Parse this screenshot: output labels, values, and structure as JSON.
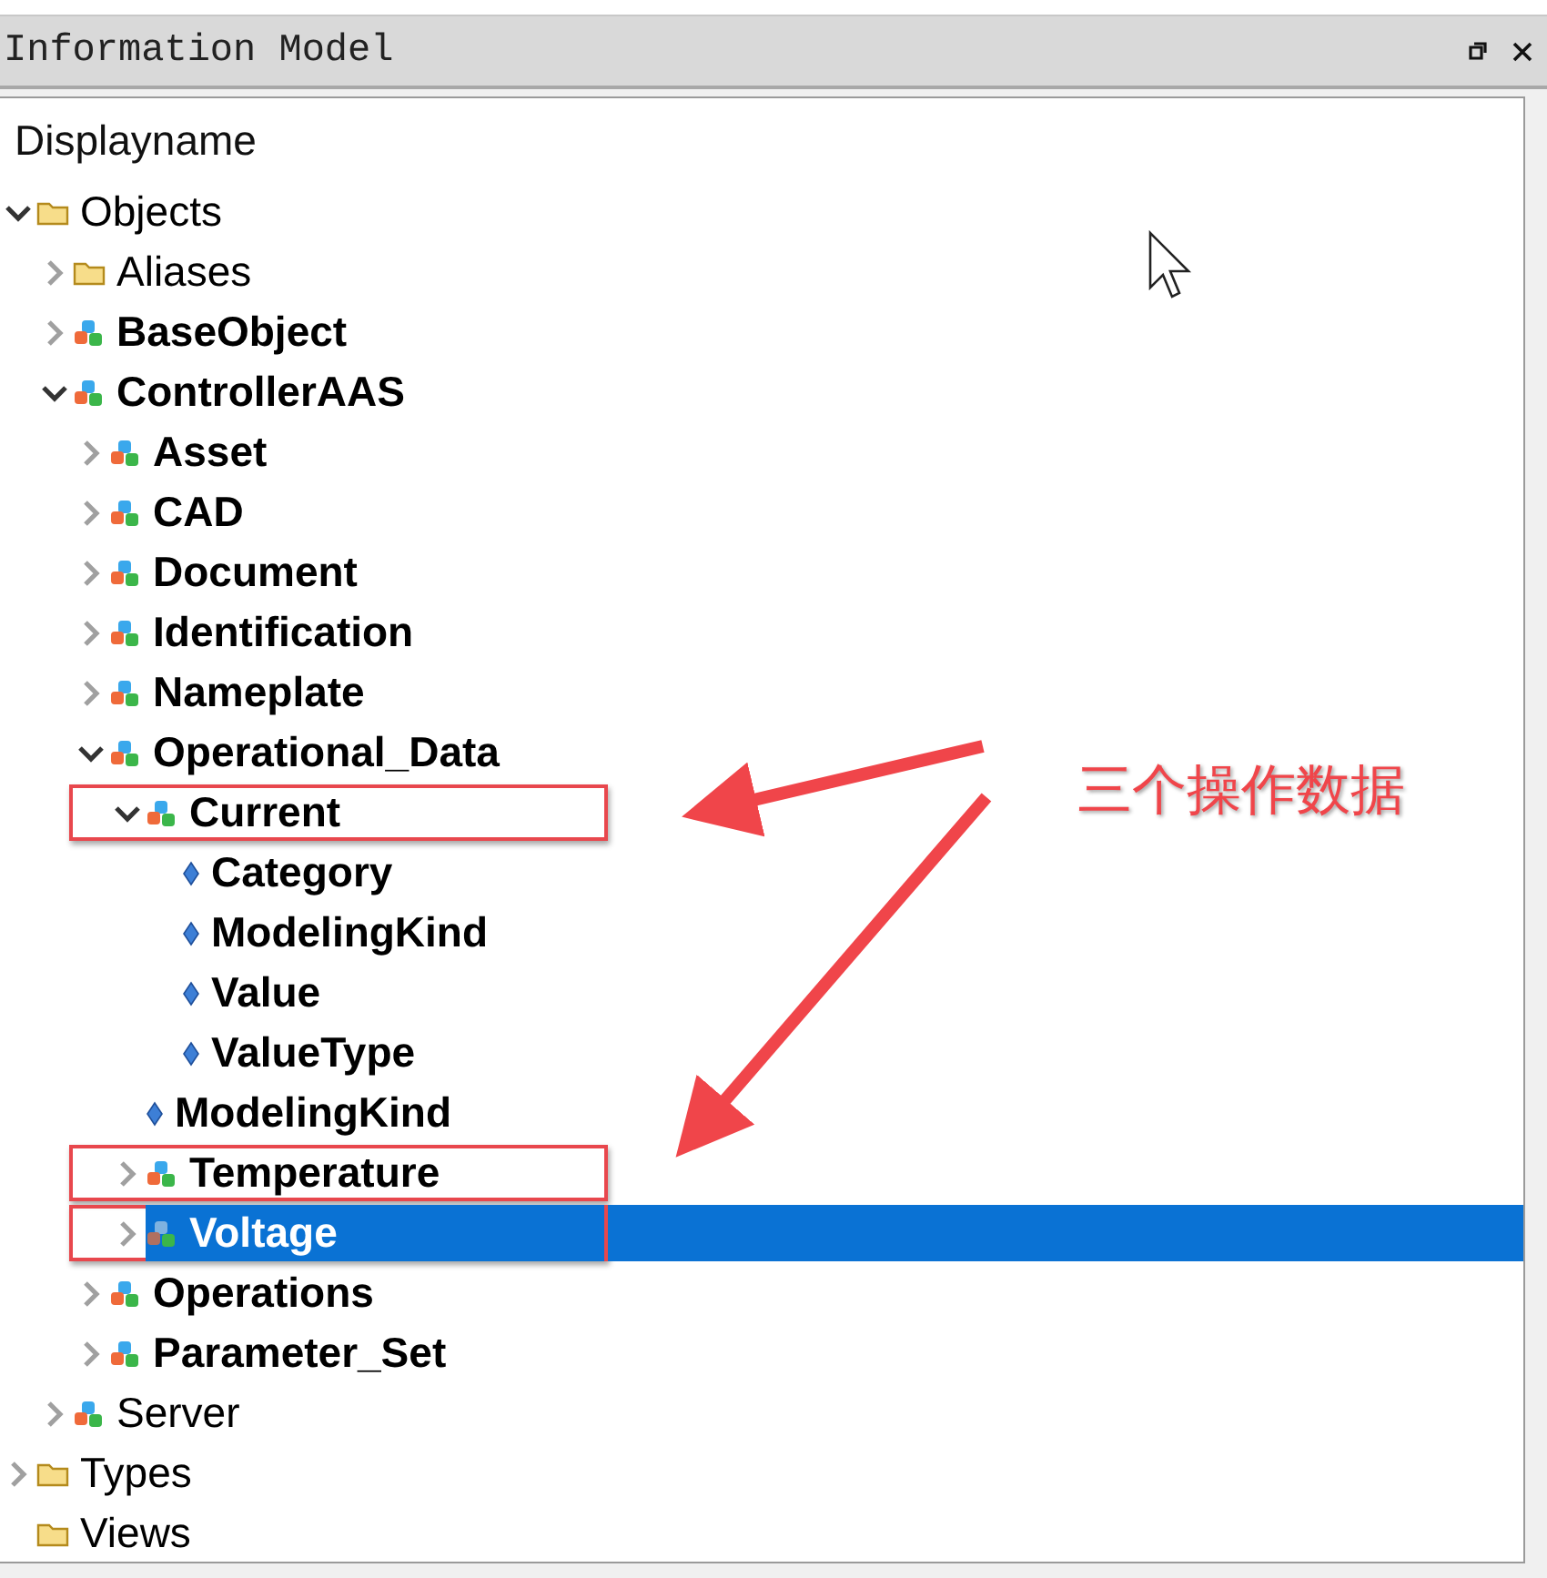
{
  "window": {
    "title": "Information Model"
  },
  "column_header": "Displayname",
  "tree": [
    {
      "label": "Objects",
      "kind": "folder",
      "bold": false,
      "expanded": true,
      "selected": false,
      "framed": false,
      "children": [
        {
          "label": "Aliases",
          "kind": "folder",
          "bold": false,
          "expanded": false,
          "selected": false,
          "framed": false
        },
        {
          "label": "BaseObject",
          "kind": "object",
          "bold": true,
          "expanded": false,
          "selected": false,
          "framed": false
        },
        {
          "label": "ControllerAAS",
          "kind": "object",
          "bold": true,
          "expanded": true,
          "selected": false,
          "framed": false,
          "children": [
            {
              "label": "Asset",
              "kind": "object",
              "bold": true,
              "expanded": false,
              "selected": false,
              "framed": false
            },
            {
              "label": "CAD",
              "kind": "object",
              "bold": true,
              "expanded": false,
              "selected": false,
              "framed": false
            },
            {
              "label": "Document",
              "kind": "object",
              "bold": true,
              "expanded": false,
              "selected": false,
              "framed": false
            },
            {
              "label": "Identification",
              "kind": "object",
              "bold": true,
              "expanded": false,
              "selected": false,
              "framed": false
            },
            {
              "label": "Nameplate",
              "kind": "object",
              "bold": true,
              "expanded": false,
              "selected": false,
              "framed": false
            },
            {
              "label": "Operational_Data",
              "kind": "object",
              "bold": true,
              "expanded": true,
              "selected": false,
              "framed": false,
              "children": [
                {
                  "label": "Current",
                  "kind": "object",
                  "bold": true,
                  "expanded": true,
                  "selected": false,
                  "framed": true,
                  "children": [
                    {
                      "label": "Category",
                      "kind": "variable",
                      "bold": true,
                      "selected": false,
                      "framed": false
                    },
                    {
                      "label": "ModelingKind",
                      "kind": "variable",
                      "bold": true,
                      "selected": false,
                      "framed": false
                    },
                    {
                      "label": "Value",
                      "kind": "variable",
                      "bold": true,
                      "selected": false,
                      "framed": false
                    },
                    {
                      "label": "ValueType",
                      "kind": "variable",
                      "bold": true,
                      "selected": false,
                      "framed": false
                    }
                  ]
                },
                {
                  "label": "ModelingKind",
                  "kind": "variable",
                  "bold": true,
                  "selected": false,
                  "framed": false
                },
                {
                  "label": "Temperature",
                  "kind": "object",
                  "bold": true,
                  "expanded": false,
                  "selected": false,
                  "framed": true
                },
                {
                  "label": "Voltage",
                  "kind": "object",
                  "bold": true,
                  "expanded": false,
                  "selected": true,
                  "framed": true
                }
              ]
            },
            {
              "label": "Operations",
              "kind": "object",
              "bold": true,
              "expanded": false,
              "selected": false,
              "framed": false
            },
            {
              "label": "Parameter_Set",
              "kind": "object",
              "bold": true,
              "expanded": false,
              "selected": false,
              "framed": false
            }
          ]
        },
        {
          "label": "Server",
          "kind": "object",
          "bold": false,
          "expanded": false,
          "selected": false,
          "framed": false
        }
      ]
    },
    {
      "label": "Types",
      "kind": "folder",
      "bold": false,
      "expanded": false,
      "selected": false,
      "framed": false
    },
    {
      "label": "Views",
      "kind": "folder",
      "bold": false,
      "selected": false,
      "framed": false
    }
  ],
  "annotation": {
    "text": "三个操作数据"
  }
}
